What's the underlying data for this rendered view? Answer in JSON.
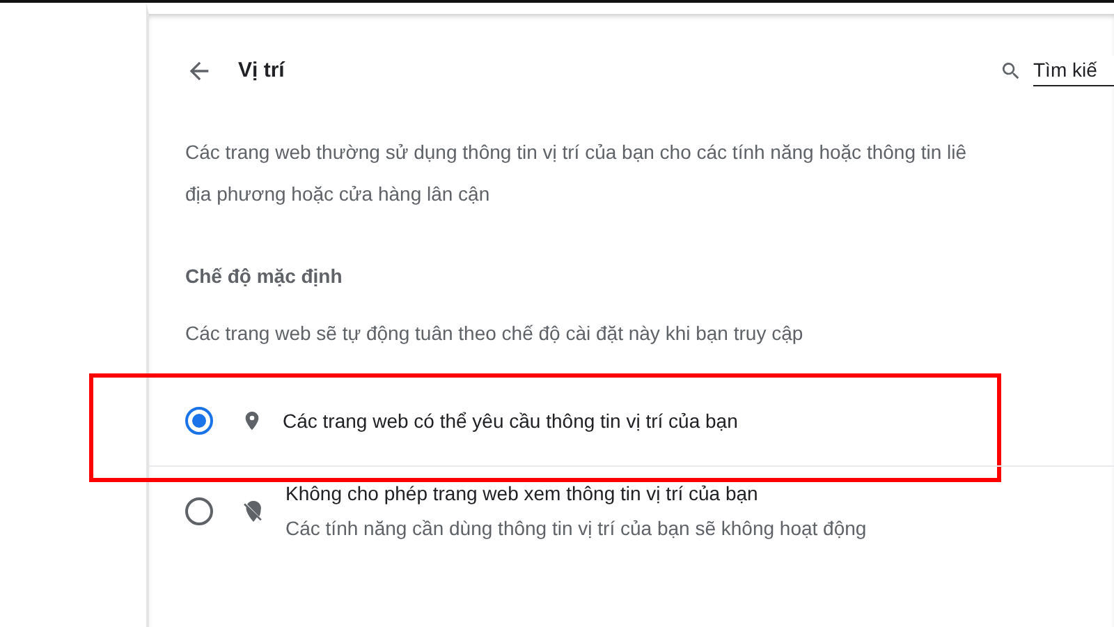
{
  "header": {
    "title": "Vị trí",
    "search": {
      "placeholder": "Tìm kiế"
    }
  },
  "description": [
    "Các trang web thường sử dụng thông tin vị trí của bạn cho các tính năng hoặc thông tin liê",
    "địa phương hoặc cửa hàng lân cận"
  ],
  "section": {
    "title": "Chế độ mặc định",
    "subtitle": "Các trang web sẽ tự động tuân theo chế độ cài đặt này khi bạn truy cập"
  },
  "options": [
    {
      "kind": "allow",
      "label": "Các trang web có thể yêu cầu thông tin vị trí của bạn",
      "selected": true,
      "highlighted": true
    },
    {
      "kind": "block",
      "label": "Không cho phép trang web xem thông tin vị trí của bạn",
      "sublabel": "Các tính năng cần dùng thông tin vị trí của bạn sẽ không hoạt động",
      "selected": false,
      "highlighted": false
    }
  ]
}
